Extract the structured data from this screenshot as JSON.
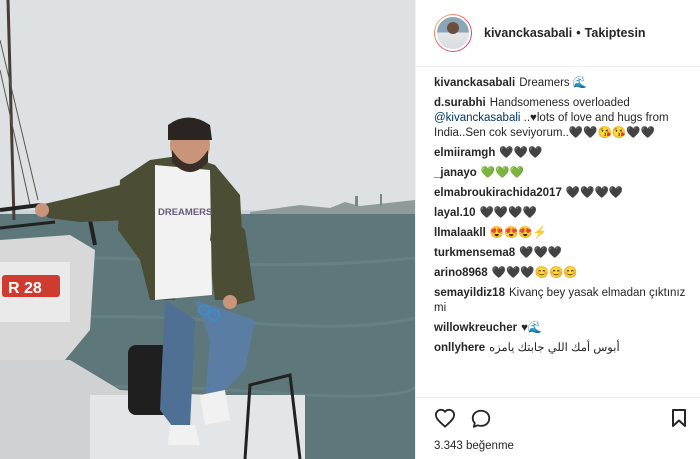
{
  "header": {
    "username": "kivanckasabali",
    "separator": "•",
    "follow_label": "Takiptesin"
  },
  "comments": [
    {
      "user": "kivanckasabali",
      "text": "Dreamers 🌊"
    },
    {
      "user": "d.surabhi",
      "text_before": "Handsomeness overloaded ",
      "mention": "@kivanckasabali",
      "text": " ..♥lots of love and hugs from India..Sen cok seviyorum..🖤🖤😘😘🖤🖤"
    },
    {
      "user": "elmiiramgh",
      "text": "🖤🖤🖤"
    },
    {
      "user": "_janayo",
      "text": "💚💚💚"
    },
    {
      "user": "elmabroukirachida2017",
      "text": "🖤🖤🖤🖤"
    },
    {
      "user": "layal.10",
      "text": "🖤🖤🖤🖤"
    },
    {
      "user": "llmalaakll",
      "text": "😍😍😍⚡"
    },
    {
      "user": "turkmensema8",
      "text": "🖤🖤🖤"
    },
    {
      "user": "arino8968",
      "text": "🖤🖤🖤😊😊😊"
    },
    {
      "user": "semayildiz18",
      "text": "Kivanç bey yasak elmadan çıktınız mi"
    },
    {
      "user": "willowkreucher",
      "text": "♥🌊"
    },
    {
      "user": "onllyhere",
      "text": "أبوس أمك اللي جابتك يامزه"
    }
  ],
  "footer": {
    "like_icon": "heart-outline-icon",
    "comment_icon": "comment-bubble-icon",
    "save_icon": "bookmark-icon",
    "likes_text": "3.343 beğenme"
  },
  "photo": {
    "shirt_text": "DREAMERS",
    "boat_text": "R 28"
  }
}
